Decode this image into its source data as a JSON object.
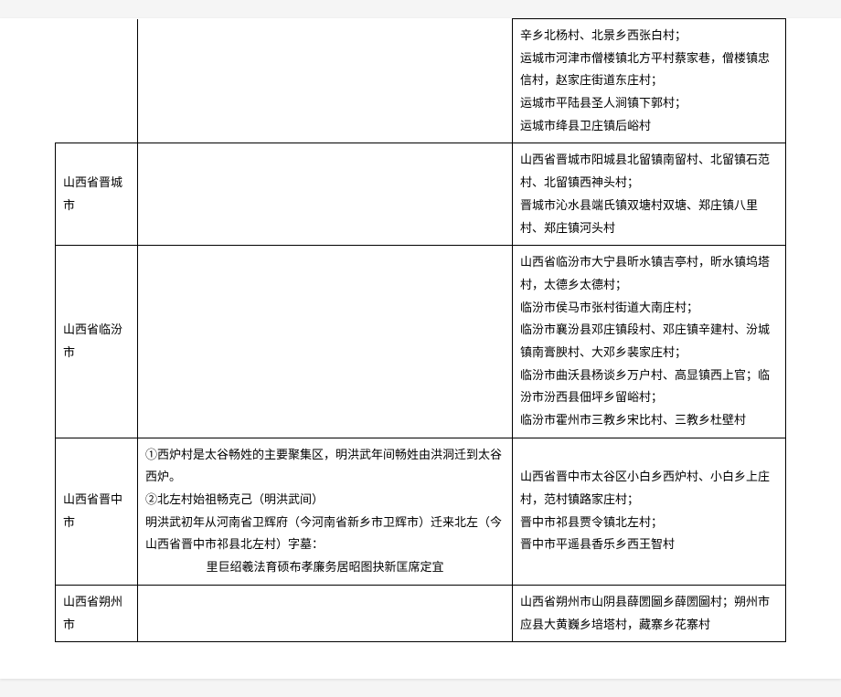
{
  "rows": [
    {
      "col1": "",
      "col2": "",
      "col3": "辛乡北杨村、北景乡西张白村；\n运城市河津市僧楼镇北方平村蔡家巷，僧楼镇忠信村，赵家庄街道东庄村；\n运城市平陆县圣人涧镇下郭村；\n运城市绛县卫庄镇后峪村"
    },
    {
      "col1": "山西省晋城市",
      "col2": "",
      "col3": "山西省晋城市阳城县北留镇南留村、北留镇石范村、北留镇西神头村；\n晋城市沁水县端氏镇双塘村双塘、郑庄镇八里村、郑庄镇河头村"
    },
    {
      "col1": "山西省临汾市",
      "col2": "",
      "col3": "山西省临汾市大宁县昕水镇吉亭村，昕水镇坞塔村，太德乡太德村；\n临汾市侯马市张村街道大南庄村；\n临汾市襄汾县邓庄镇段村、邓庄镇辛建村、汾城镇南膏腴村、大邓乡裴家庄村；\n临汾市曲沃县杨谈乡万户村、高显镇西上官；临汾市汾西县佃坪乡留峪村；\n临汾市霍州市三教乡宋比村、三教乡杜壁村"
    },
    {
      "col1": "山西省晋中市",
      "col2": "①西炉村是太谷畅姓的主要聚集区，明洪武年间畅姓由洪洞迁到太谷西炉。\n②北左村始祖畅克己（明洪武间）\n明洪武初年从河南省卫辉府（今河南省新乡市卫辉市）迁来北左（今山西省晋中市祁县北左村）字墓：",
      "col2_center": "里巨绍羲法育硕布孝廉务居昭图抉新匡席定宜",
      "col3": "山西省晋中市太谷区小白乡西炉村、小白乡上庄村，范村镇路家庄村；\n晋中市祁县贾令镇北左村；\n晋中市平遥县香乐乡西王智村"
    },
    {
      "col1": "山西省朔州市",
      "col2": "",
      "col3": "山西省朔州市山阴县薛圐圙乡薛圐圙村；朔州市应县大黄巍乡培塔村，藏寨乡花寨村"
    }
  ]
}
